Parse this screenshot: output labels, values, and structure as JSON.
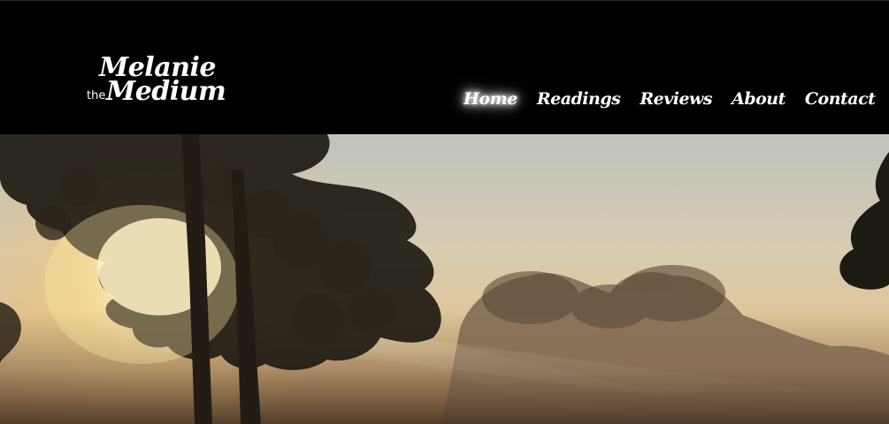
{
  "logo": {
    "line1": "Melanie",
    "the": "the",
    "line2": "Medium"
  },
  "nav": {
    "items": [
      {
        "label": "Home",
        "active": true
      },
      {
        "label": "Readings",
        "active": false
      },
      {
        "label": "Reviews",
        "active": false
      },
      {
        "label": "About",
        "active": false
      },
      {
        "label": "Contact",
        "active": false
      }
    ]
  },
  "hero": {
    "image": "misty-forest-sunrise-photo"
  },
  "colors": {
    "header_bg": "#000000",
    "text": "#ffffff"
  }
}
